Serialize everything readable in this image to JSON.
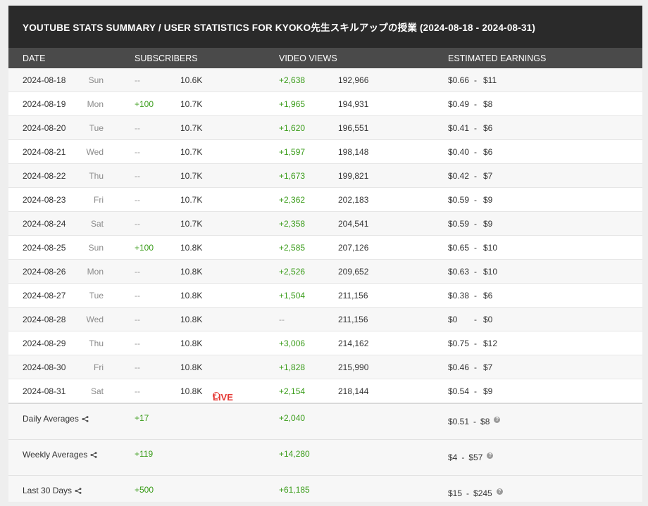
{
  "title": "YOUTUBE STATS SUMMARY / USER STATISTICS FOR KYOKO先生スキルアップの授業 (2024-08-18 - 2024-08-31)",
  "headers": {
    "date": "DATE",
    "subscribers": "SUBSCRIBERS",
    "views": "VIDEO VIEWS",
    "earnings": "ESTIMATED EARNINGS"
  },
  "rows": [
    {
      "date": "2024-08-18",
      "day": "Sun",
      "sub_change": "--",
      "subs": "10.6K",
      "live": "",
      "view_change": "+2,638",
      "views": "192,966",
      "earn_low": "$0.66",
      "earn_high": "$11"
    },
    {
      "date": "2024-08-19",
      "day": "Mon",
      "sub_change": "+100",
      "subs": "10.7K",
      "live": "",
      "view_change": "+1,965",
      "views": "194,931",
      "earn_low": "$0.49",
      "earn_high": "$8"
    },
    {
      "date": "2024-08-20",
      "day": "Tue",
      "sub_change": "--",
      "subs": "10.7K",
      "live": "",
      "view_change": "+1,620",
      "views": "196,551",
      "earn_low": "$0.41",
      "earn_high": "$6"
    },
    {
      "date": "2024-08-21",
      "day": "Wed",
      "sub_change": "--",
      "subs": "10.7K",
      "live": "",
      "view_change": "+1,597",
      "views": "198,148",
      "earn_low": "$0.40",
      "earn_high": "$6"
    },
    {
      "date": "2024-08-22",
      "day": "Thu",
      "sub_change": "--",
      "subs": "10.7K",
      "live": "",
      "view_change": "+1,673",
      "views": "199,821",
      "earn_low": "$0.42",
      "earn_high": "$7"
    },
    {
      "date": "2024-08-23",
      "day": "Fri",
      "sub_change": "--",
      "subs": "10.7K",
      "live": "",
      "view_change": "+2,362",
      "views": "202,183",
      "earn_low": "$0.59",
      "earn_high": "$9"
    },
    {
      "date": "2024-08-24",
      "day": "Sat",
      "sub_change": "--",
      "subs": "10.7K",
      "live": "",
      "view_change": "+2,358",
      "views": "204,541",
      "earn_low": "$0.59",
      "earn_high": "$9"
    },
    {
      "date": "2024-08-25",
      "day": "Sun",
      "sub_change": "+100",
      "subs": "10.8K",
      "live": "",
      "view_change": "+2,585",
      "views": "207,126",
      "earn_low": "$0.65",
      "earn_high": "$10"
    },
    {
      "date": "2024-08-26",
      "day": "Mon",
      "sub_change": "--",
      "subs": "10.8K",
      "live": "",
      "view_change": "+2,526",
      "views": "209,652",
      "earn_low": "$0.63",
      "earn_high": "$10"
    },
    {
      "date": "2024-08-27",
      "day": "Tue",
      "sub_change": "--",
      "subs": "10.8K",
      "live": "",
      "view_change": "+1,504",
      "views": "211,156",
      "earn_low": "$0.38",
      "earn_high": "$6"
    },
    {
      "date": "2024-08-28",
      "day": "Wed",
      "sub_change": "--",
      "subs": "10.8K",
      "live": "",
      "view_change": "--",
      "views": "211,156",
      "earn_low": "$0",
      "earn_high": "$0"
    },
    {
      "date": "2024-08-29",
      "day": "Thu",
      "sub_change": "--",
      "subs": "10.8K",
      "live": "",
      "view_change": "+3,006",
      "views": "214,162",
      "earn_low": "$0.75",
      "earn_high": "$12"
    },
    {
      "date": "2024-08-30",
      "day": "Fri",
      "sub_change": "--",
      "subs": "10.8K",
      "live": "",
      "view_change": "+1,828",
      "views": "215,990",
      "earn_low": "$0.46",
      "earn_high": "$7"
    },
    {
      "date": "2024-08-31",
      "day": "Sat",
      "sub_change": "--",
      "subs": "10.8K",
      "live": "LIVE",
      "view_change": "+2,154",
      "views": "218,144",
      "earn_low": "$0.54",
      "earn_high": "$9"
    }
  ],
  "summary": [
    {
      "label": "Daily Averages",
      "subs": "+17",
      "views": "+2,040",
      "earn_low": "$0.51",
      "earn_high": "$8"
    },
    {
      "label": "Weekly Averages",
      "subs": "+119",
      "views": "+14,280",
      "earn_low": "$4",
      "earn_high": "$57"
    },
    {
      "label": "Last 30 Days",
      "subs": "+500",
      "views": "+61,185",
      "earn_low": "$15",
      "earn_high": "$245"
    }
  ],
  "earn_separator": "-",
  "help_glyph": "?",
  "colors": {
    "green": "#3a9c1a",
    "live": "#e53935",
    "title_bg": "#2a2a2a",
    "header_bg": "#4a4a4a"
  }
}
